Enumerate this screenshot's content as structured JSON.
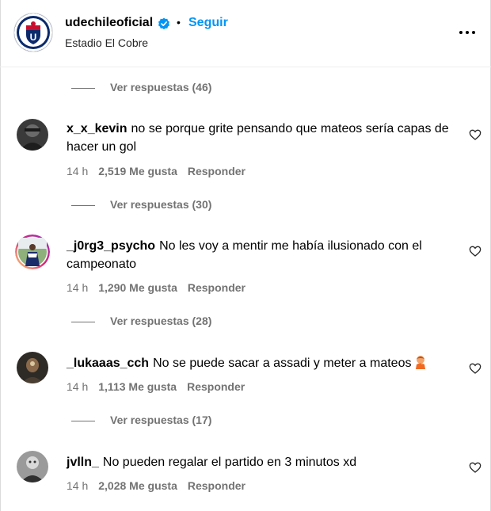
{
  "post": {
    "username": "udechileoficial",
    "separator": "•",
    "follow_label": "Seguir",
    "location": "Estadio El Cobre"
  },
  "replies": [
    {
      "label": "Ver respuestas (46)"
    },
    {
      "label": "Ver respuestas (30)"
    },
    {
      "label": "Ver respuestas (28)"
    },
    {
      "label": "Ver respuestas (17)"
    }
  ],
  "comments": [
    {
      "user": "x_x_kevin",
      "text": "no se porque grite pensando que mateos sería capas de hacer un gol",
      "time": "14 h",
      "likes": "2,519 Me gusta",
      "reply": "Responder"
    },
    {
      "user": "_j0rg3_psycho",
      "text": "No les voy a mentir me había ilusionado con el campeonato",
      "time": "14 h",
      "likes": "1,290 Me gusta",
      "reply": "Responder"
    },
    {
      "user": "_lukaaas_cch",
      "text": "No se puede sacar a assadi y meter a mateos",
      "time": "14 h",
      "likes": "1,113 Me gusta",
      "reply": "Responder"
    },
    {
      "user": "jvlln_",
      "text": "No pueden regalar el partido en 3 minutos xd",
      "time": "14 h",
      "likes": "2,028 Me gusta",
      "reply": "Responder"
    }
  ],
  "icons": {
    "verified": "verified-badge-icon",
    "more": "more-options-icon",
    "like": "heart-icon",
    "emoji": "person-facepalming-emoji"
  },
  "colors": {
    "link_blue": "#0095f6",
    "secondary_text": "#737373",
    "verified_blue": "#0095f6"
  }
}
